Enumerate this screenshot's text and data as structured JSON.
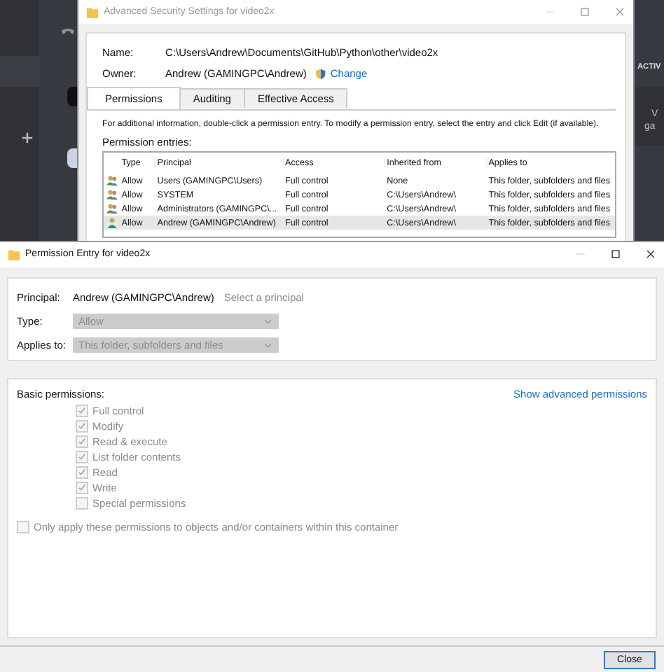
{
  "background_app": {
    "texts": [
      "ACTIV",
      "V",
      "ga"
    ]
  },
  "security_window": {
    "title": "Advanced Security Settings for video2x",
    "name_label": "Name:",
    "name_value": "C:\\Users\\Andrew\\Documents\\GitHub\\Python\\other\\video2x",
    "owner_label": "Owner:",
    "owner_value": "Andrew (GAMINGPC\\Andrew)",
    "change_link": "Change",
    "tabs": [
      {
        "label": "Permissions",
        "selected": true
      },
      {
        "label": "Auditing",
        "selected": false
      },
      {
        "label": "Effective Access",
        "selected": false
      }
    ],
    "info": "For additional information, double-click a permission entry. To modify a permission entry, select the entry and click Edit (if available).",
    "entries_label": "Permission entries:",
    "columns": [
      "Type",
      "Principal",
      "Access",
      "Inherited from",
      "Applies to"
    ],
    "rows": [
      {
        "kind": "group",
        "type": "Allow",
        "principal": "Users (GAMINGPC\\Users)",
        "access": "Full control",
        "inherited_from": "None",
        "applies_to": "This folder, subfolders and files",
        "selected": false
      },
      {
        "kind": "group",
        "type": "Allow",
        "principal": "SYSTEM",
        "access": "Full control",
        "inherited_from": "C:\\Users\\Andrew\\",
        "applies_to": "This folder, subfolders and files",
        "selected": false
      },
      {
        "kind": "group",
        "type": "Allow",
        "principal": "Administrators (GAMINGPC\\...",
        "access": "Full control",
        "inherited_from": "C:\\Users\\Andrew\\",
        "applies_to": "This folder, subfolders and files",
        "selected": false
      },
      {
        "kind": "user",
        "type": "Allow",
        "principal": "Andrew (GAMINGPC\\Andrew)",
        "access": "Full control",
        "inherited_from": "C:\\Users\\Andrew\\",
        "applies_to": "This folder, subfolders and files",
        "selected": true
      }
    ]
  },
  "entry_window": {
    "title": "Permission Entry for video2x",
    "principal_label": "Principal:",
    "principal_value": "Andrew (GAMINGPC\\Andrew)",
    "select_principal_link": "Select a principal",
    "type_label": "Type:",
    "type_value": "Allow",
    "type_disabled": true,
    "applies_label": "Applies to:",
    "applies_value": "This folder, subfolders and files",
    "applies_disabled": true,
    "basic_label": "Basic permissions:",
    "advanced_link": "Show advanced permissions",
    "permissions": [
      {
        "label": "Full control",
        "checked": true,
        "disabled": true
      },
      {
        "label": "Modify",
        "checked": true,
        "disabled": true
      },
      {
        "label": "Read & execute",
        "checked": true,
        "disabled": true
      },
      {
        "label": "List folder contents",
        "checked": true,
        "disabled": true
      },
      {
        "label": "Read",
        "checked": true,
        "disabled": true
      },
      {
        "label": "Write",
        "checked": true,
        "disabled": true
      },
      {
        "label": "Special permissions",
        "checked": false,
        "disabled": true
      }
    ],
    "only_apply": {
      "label": "Only apply these permissions to objects and/or containers within this container",
      "checked": false,
      "disabled": true
    },
    "buttons": [
      "Close"
    ]
  }
}
